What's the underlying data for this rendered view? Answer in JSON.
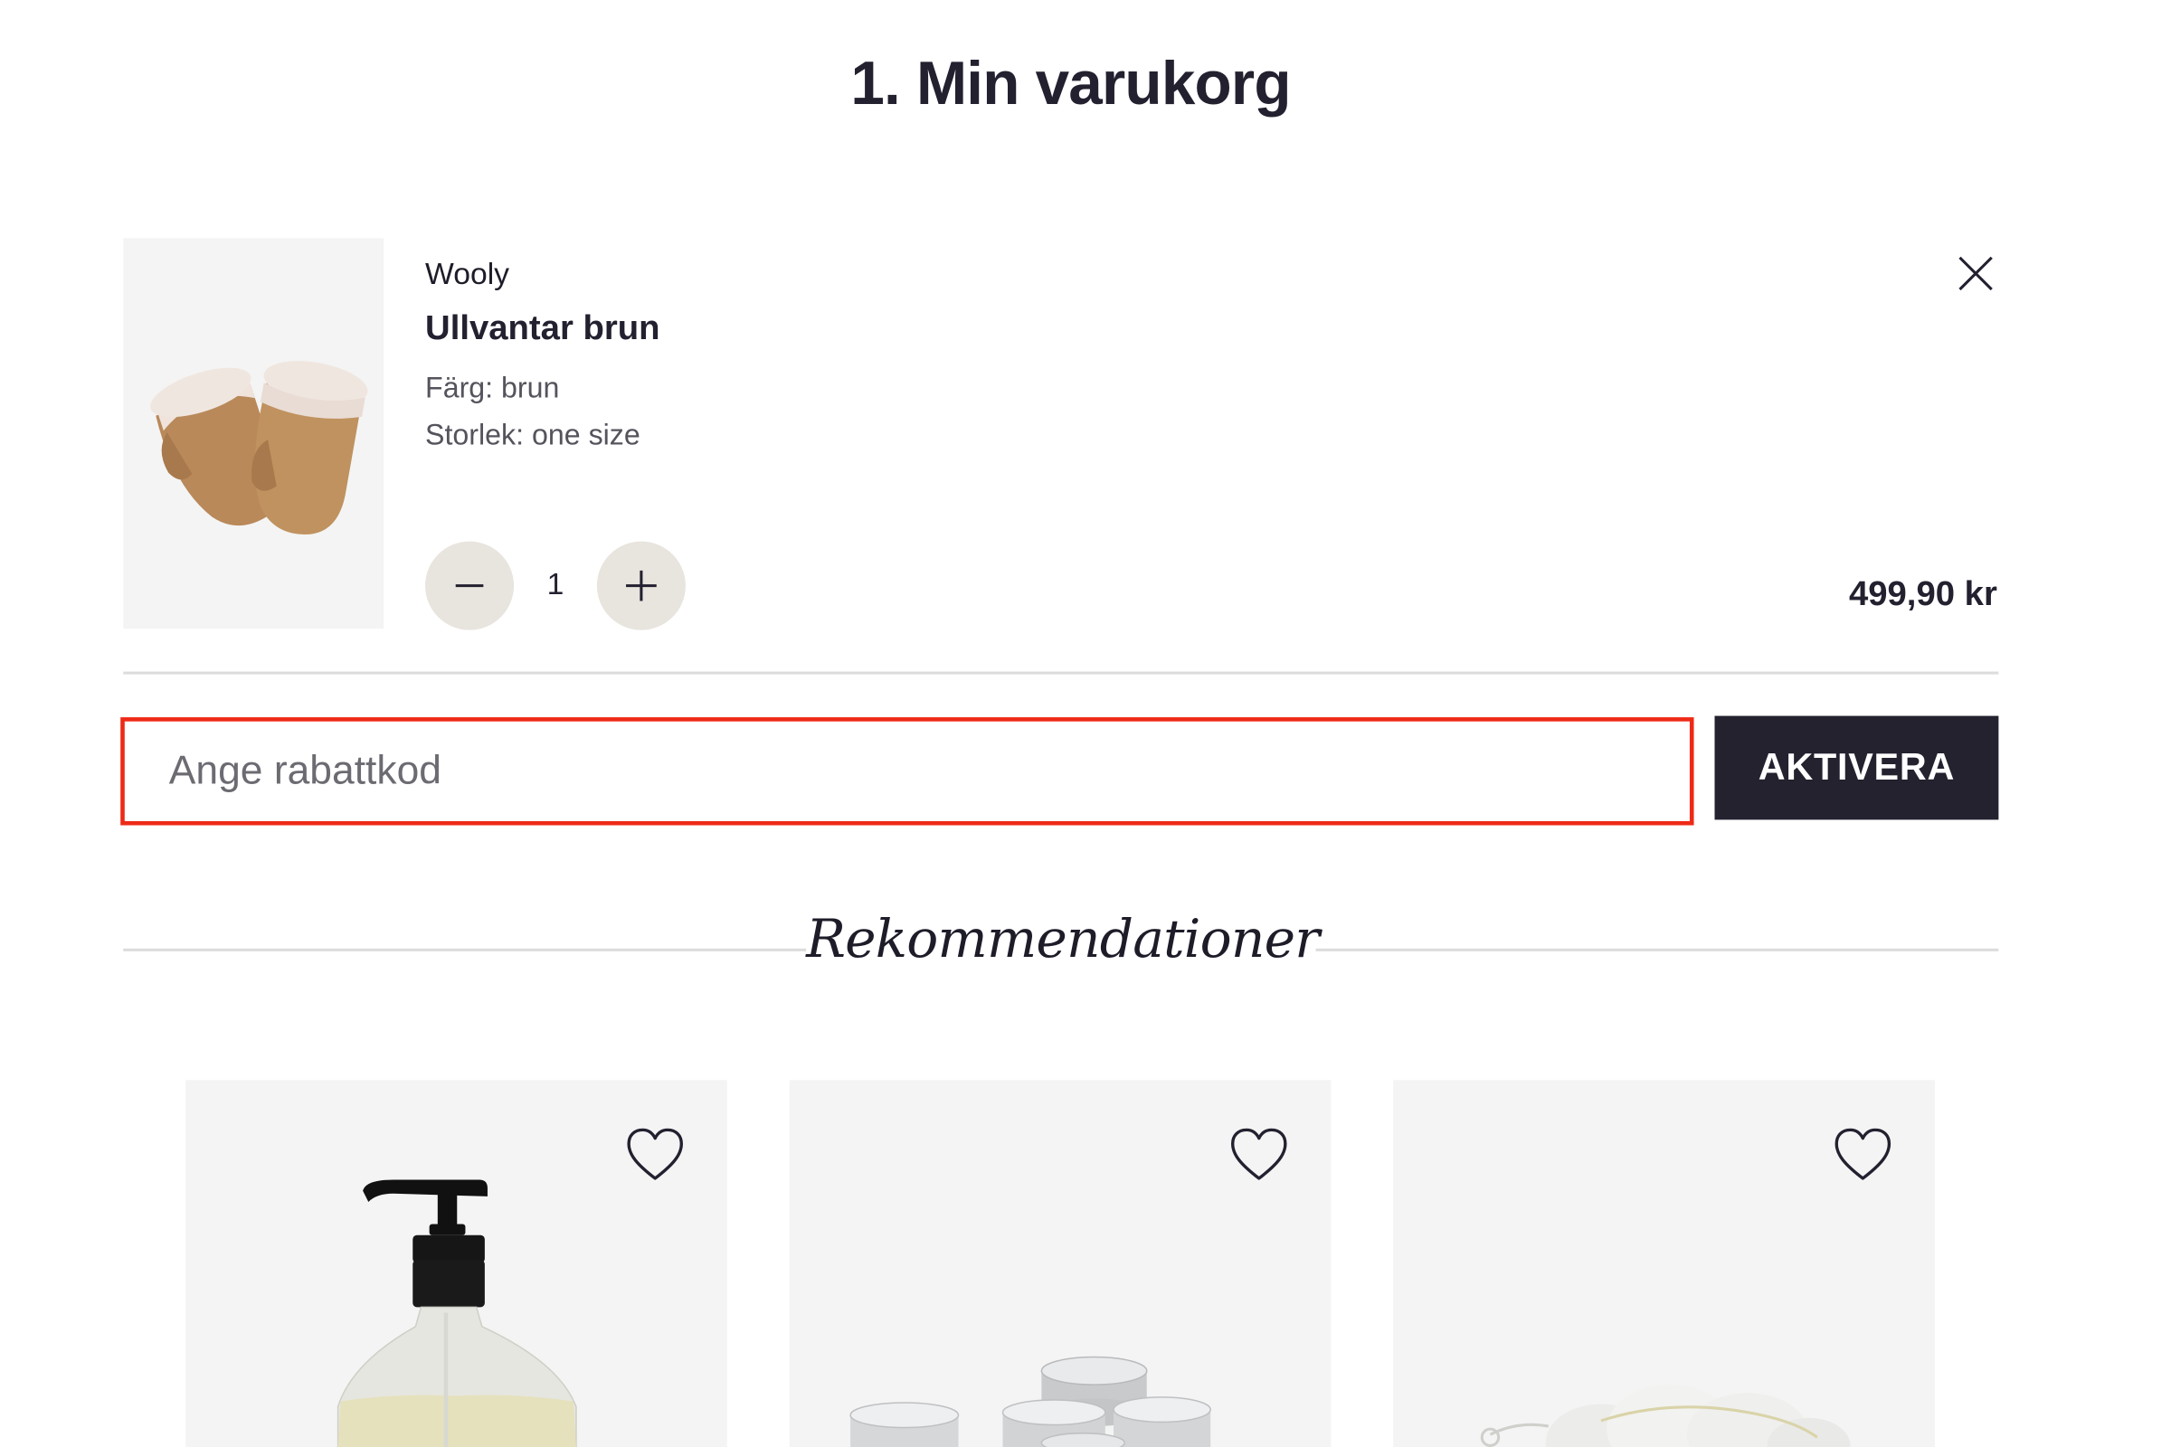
{
  "page": {
    "title": "1. Min varukorg"
  },
  "cart": {
    "item": {
      "brand": "Wooly",
      "name": "Ullvantar brun",
      "color": "Färg: brun",
      "size": "Storlek: one size",
      "quantity": "1",
      "price": "499,90 kr",
      "image_icon": "mittens-image"
    },
    "controls": {
      "decrease_icon": "minus-icon",
      "increase_icon": "plus-icon",
      "remove_icon": "close-icon"
    }
  },
  "discount": {
    "placeholder": "Ange rabattkod",
    "value": "",
    "button_label": "AKTIVERA",
    "highlight_color": "#ee2a16"
  },
  "recommendations": {
    "heading": "Rekommendationer",
    "products": [
      {
        "image_icon": "soap-bottle-image",
        "favorite_icon": "heart-icon"
      },
      {
        "image_icon": "tealight-candles-image",
        "favorite_icon": "heart-icon"
      },
      {
        "image_icon": "bath-sponge-image",
        "favorite_icon": "heart-icon"
      }
    ]
  },
  "colors": {
    "text_dark": "#23202f",
    "button_dark": "#24222f",
    "qty_button_bg": "#e8e4de",
    "card_bg": "#f4f4f4"
  }
}
